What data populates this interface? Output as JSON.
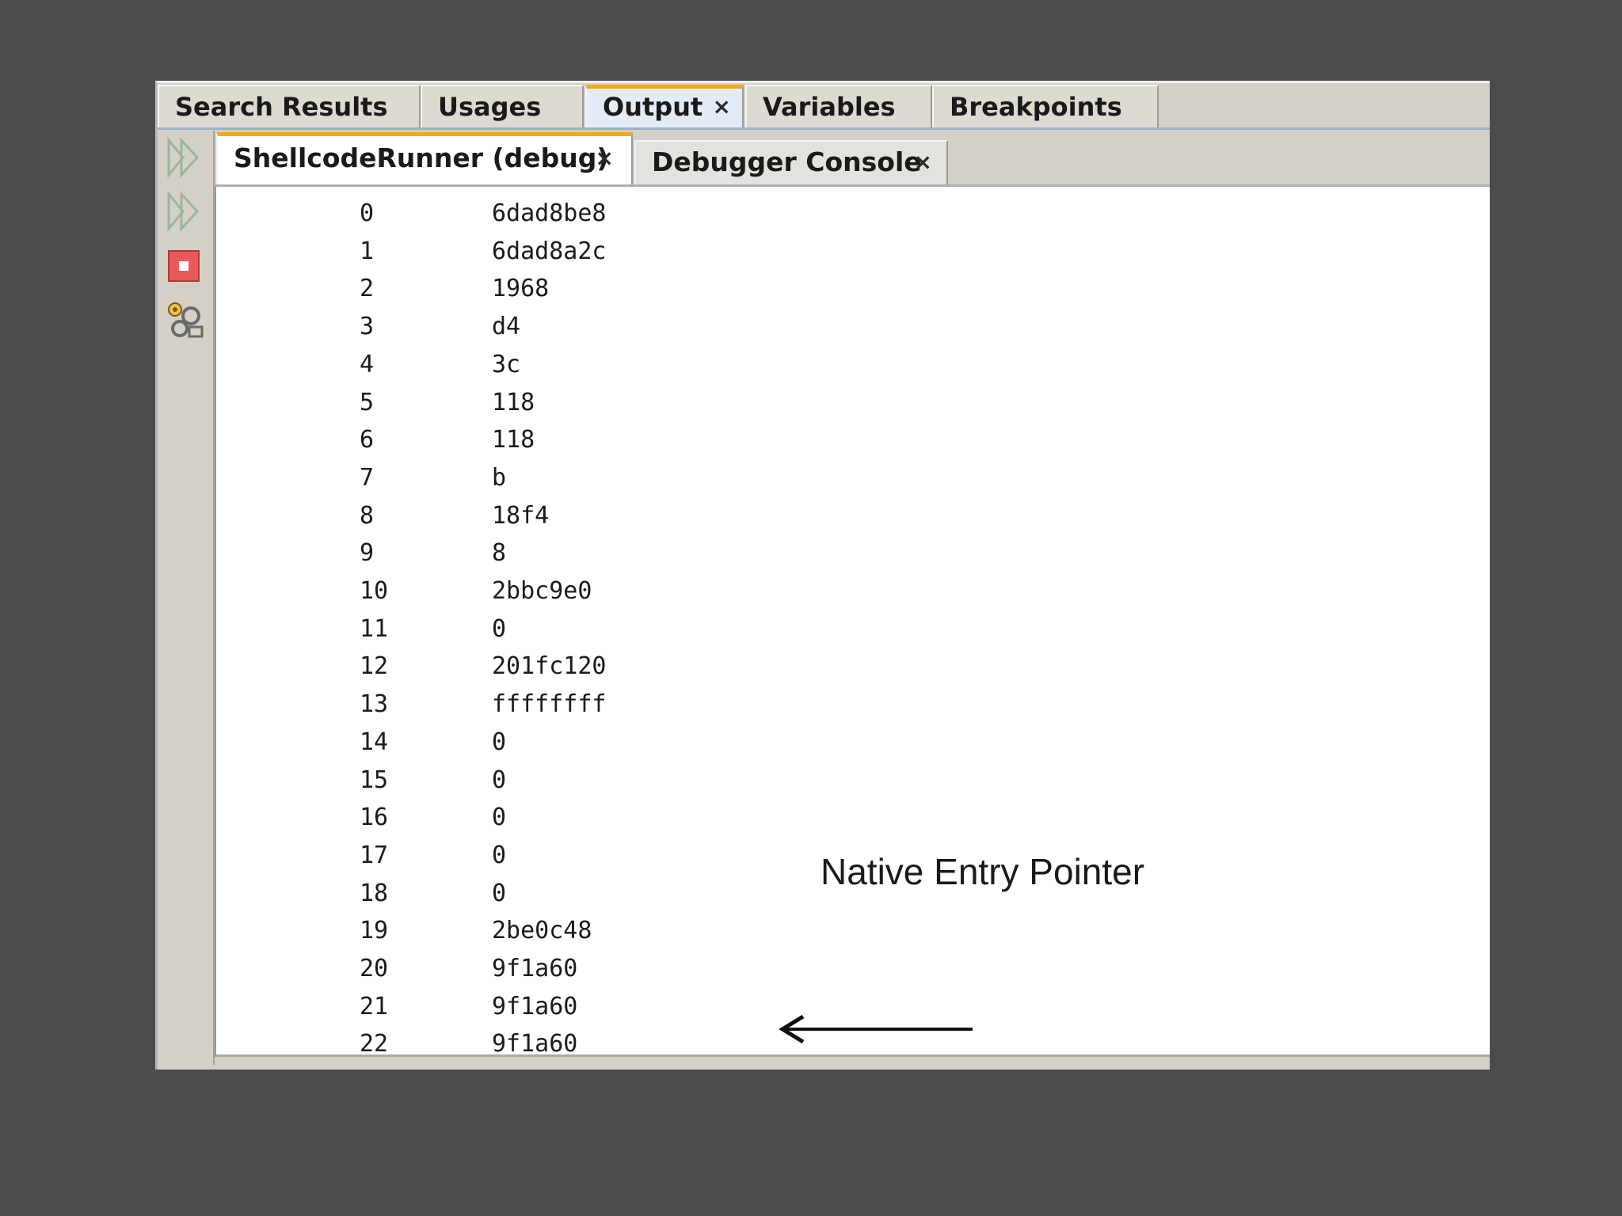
{
  "top_tabs": [
    {
      "label": "Search Results",
      "active": false
    },
    {
      "label": "Usages",
      "active": false
    },
    {
      "label": "Output",
      "active": true
    },
    {
      "label": "Variables",
      "active": false
    },
    {
      "label": "Breakpoints",
      "active": false
    }
  ],
  "close_glyph": "×",
  "sub_tabs": [
    {
      "label": "ShellcodeRunner (debug)",
      "active": true
    },
    {
      "label": "Debugger Console",
      "active": false
    }
  ],
  "toolbar": {
    "icons": [
      "rerun-icon",
      "continue-icon",
      "stop-icon",
      "settings-icon"
    ],
    "stop_color": "#e85a5a"
  },
  "output_rows": [
    {
      "index": "0",
      "value": "6dad8be8"
    },
    {
      "index": "1",
      "value": "6dad8a2c"
    },
    {
      "index": "2",
      "value": "1968"
    },
    {
      "index": "3",
      "value": "d4"
    },
    {
      "index": "4",
      "value": "3c"
    },
    {
      "index": "5",
      "value": "118"
    },
    {
      "index": "6",
      "value": "118"
    },
    {
      "index": "7",
      "value": "b"
    },
    {
      "index": "8",
      "value": "18f4"
    },
    {
      "index": "9",
      "value": "8"
    },
    {
      "index": "10",
      "value": "2bbc9e0"
    },
    {
      "index": "11",
      "value": "0"
    },
    {
      "index": "12",
      "value": "201fc120"
    },
    {
      "index": "13",
      "value": "ffffffff"
    },
    {
      "index": "14",
      "value": "0"
    },
    {
      "index": "15",
      "value": "0"
    },
    {
      "index": "16",
      "value": "0"
    },
    {
      "index": "17",
      "value": "0"
    },
    {
      "index": "18",
      "value": "0"
    },
    {
      "index": "19",
      "value": "2be0c48"
    },
    {
      "index": "20",
      "value": "9f1a60"
    },
    {
      "index": "21",
      "value": "9f1a60"
    },
    {
      "index": "22",
      "value": "9f1a60"
    }
  ],
  "annotation": {
    "label": "Native Entry Pointer",
    "points_to_index": "20"
  },
  "colors": {
    "active_tab_accent": "#f5a623",
    "background": "#4c4c4c"
  }
}
